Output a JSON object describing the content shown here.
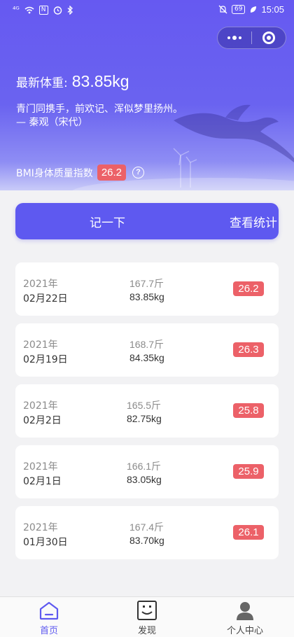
{
  "status_bar": {
    "signal": "⁴ᴳ",
    "wifi": "wifi",
    "nfc": "N",
    "alarm": "alarm",
    "bluetooth": "bluetooth",
    "mute": "mute",
    "battery": "69",
    "time": "15:05"
  },
  "header": {
    "weight_label": "最新体重:",
    "weight_value": "83.85kg",
    "poem_line": "青门同携手，前欢记、浑似梦里扬州。",
    "poem_author": "— 秦观（宋代）",
    "bmi_label": "BMI身体质量指数",
    "bmi_value": "26.2",
    "help_symbol": "?"
  },
  "actions": {
    "record_label": "记一下",
    "stats_label": "查看统计"
  },
  "records": [
    {
      "year": "2021年",
      "date": "02月22日",
      "jin": "167.7斤",
      "kg": "83.85kg",
      "bmi": "26.2"
    },
    {
      "year": "2021年",
      "date": "02月19日",
      "jin": "168.7斤",
      "kg": "84.35kg",
      "bmi": "26.3"
    },
    {
      "year": "2021年",
      "date": "02月2日",
      "jin": "165.5斤",
      "kg": "82.75kg",
      "bmi": "25.8"
    },
    {
      "year": "2021年",
      "date": "02月1日",
      "jin": "166.1斤",
      "kg": "83.05kg",
      "bmi": "25.9"
    },
    {
      "year": "2021年",
      "date": "01月30日",
      "jin": "167.4斤",
      "kg": "83.70kg",
      "bmi": "26.1"
    }
  ],
  "tabs": [
    {
      "label": "首页",
      "icon": "home-icon",
      "active": true
    },
    {
      "label": "发现",
      "icon": "smiley-face-icon",
      "active": false
    },
    {
      "label": "个人中心",
      "icon": "person-icon",
      "active": false
    }
  ],
  "colors": {
    "accent": "#5e59f0",
    "header_top": "#6659f1",
    "bmi_badge": "#ec6168",
    "background": "#f2f2f4"
  }
}
